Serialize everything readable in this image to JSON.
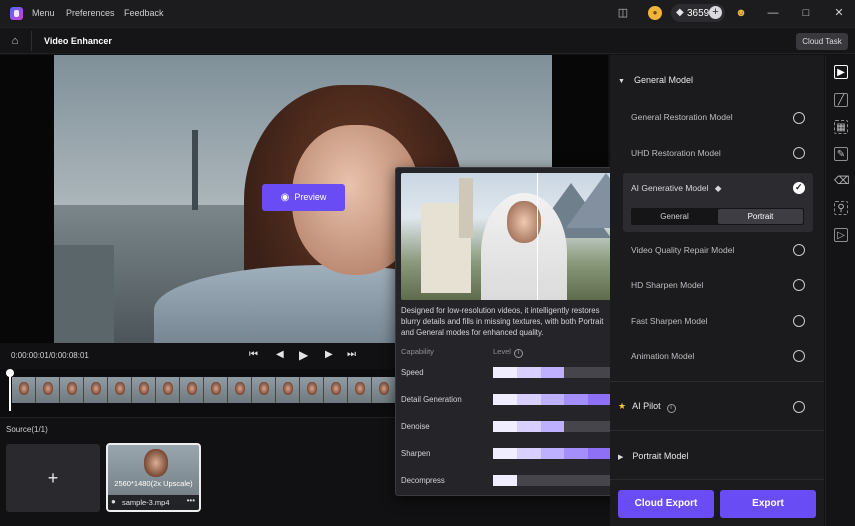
{
  "titlebar": {
    "menus": [
      "Menu",
      "Preferences",
      "Feedback"
    ],
    "credits": "3659"
  },
  "subbar": {
    "title": "Video Enhancer",
    "cloud_task": "Cloud Task"
  },
  "preview": {
    "button_label": "Preview"
  },
  "player": {
    "time": "0:00:00:01/0:00:08:01"
  },
  "source": {
    "label": "Source(1/1)",
    "add_symbol": "+",
    "clip_resolution": "2560*1480(2x Upscale)",
    "clip_name": "sample-3.mp4",
    "more_symbol": "•••"
  },
  "popup": {
    "description": "Designed for low-resolution videos, it intelligently restores blurry details and fills in missing textures, with both Portrait and General modes for enhanced quality.",
    "capability_header": "Capability",
    "level_header": "Level",
    "capabilities": [
      {
        "name": "Speed",
        "level": 3
      },
      {
        "name": "Detail Generation",
        "level": 5
      },
      {
        "name": "Denoise",
        "level": 3
      },
      {
        "name": "Sharpen",
        "level": 5
      },
      {
        "name": "Decompress",
        "level": 1
      }
    ]
  },
  "panel": {
    "general_model": "General Model",
    "models": [
      {
        "label": "General Restoration Model",
        "selected": false
      },
      {
        "label": "UHD Restoration Model",
        "selected": false
      },
      {
        "label": "AI Generative Model",
        "selected": true
      },
      {
        "label": "Video Quality Repair Model",
        "selected": false
      },
      {
        "label": "HD Sharpen Model",
        "selected": false
      },
      {
        "label": "Fast Sharpen Model",
        "selected": false
      },
      {
        "label": "Animation Model",
        "selected": false
      }
    ],
    "mode_options": [
      "General",
      "Portrait"
    ],
    "mode_selected": "Portrait",
    "ai_pilot": "AI Pilot",
    "portrait_model": "Portrait Model"
  },
  "actions": {
    "cloud_export": "Cloud Export",
    "export": "Export"
  },
  "colors": {
    "accent": "#6a4cf5",
    "background": "#111113",
    "panel": "#1b1b1e"
  },
  "icons": [
    "app-logo",
    "gift-icon",
    "coin-icon",
    "diamond-icon",
    "plus-icon",
    "user-crown-icon",
    "minimize-icon",
    "maximize-icon",
    "close-icon",
    "home-icon",
    "eye-icon",
    "skip-start-icon",
    "step-back-icon",
    "play-icon",
    "step-forward-icon",
    "skip-end-icon",
    "info-icon",
    "star-icon",
    "caret-down-icon",
    "caret-right-icon",
    "check-icon"
  ]
}
